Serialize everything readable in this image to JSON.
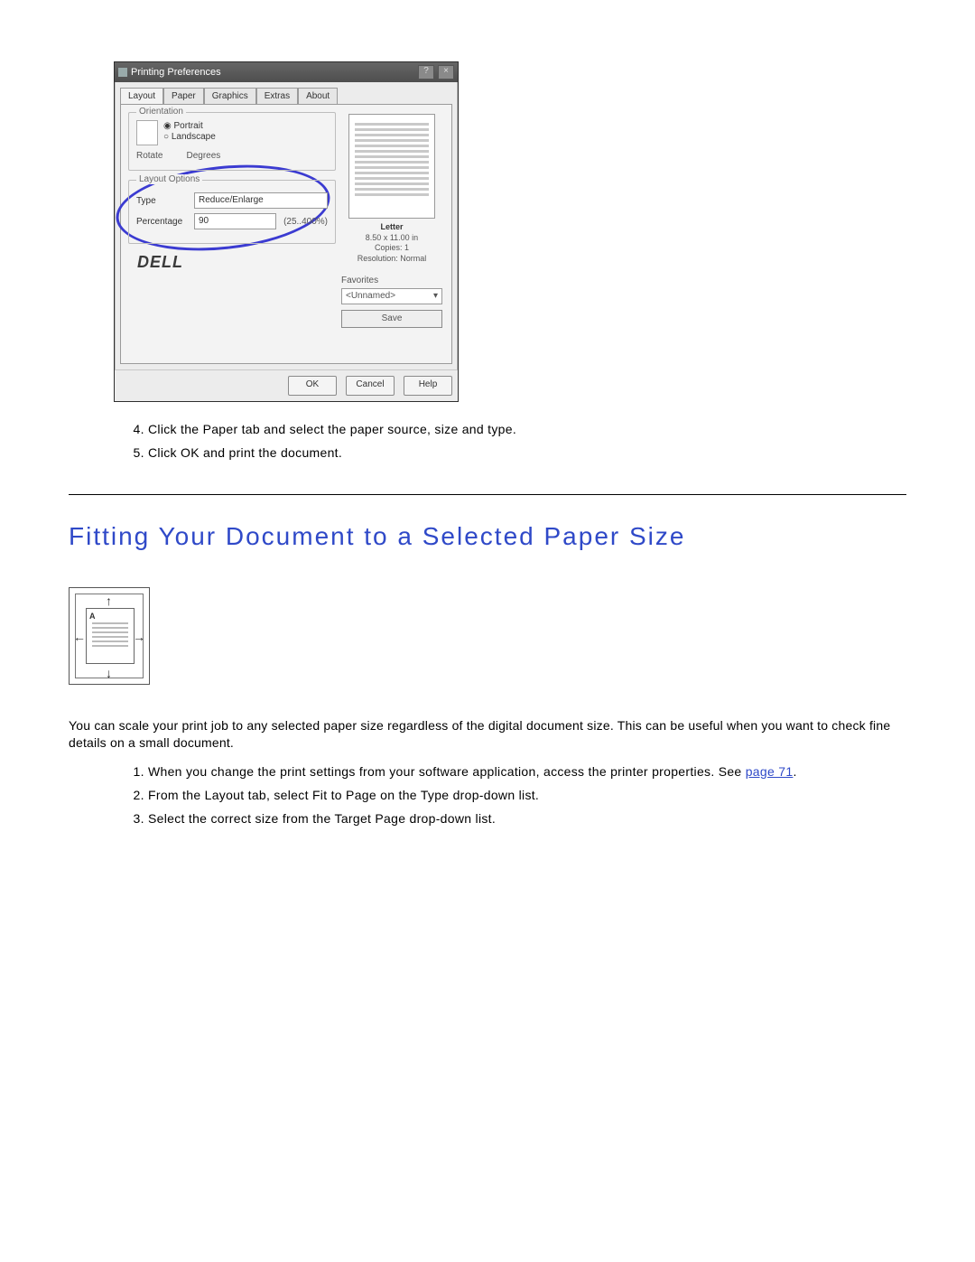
{
  "dialog": {
    "title": "Printing Preferences",
    "winbtn_help": "?",
    "winbtn_close": "×",
    "tabs": [
      "Layout",
      "Paper",
      "Graphics",
      "Extras",
      "About"
    ],
    "orientation": {
      "legend": "Orientation",
      "portrait": "Portrait",
      "landscape": "Landscape",
      "rotate": "Rotate",
      "degrees": "Degrees"
    },
    "layout_options": {
      "legend": "Layout Options",
      "type_lbl": "Type",
      "type_val": "Reduce/Enlarge",
      "pct_lbl": "Percentage",
      "pct_val": "90",
      "pct_unit": "(25..400%)"
    },
    "preview": {
      "paper": "Letter",
      "dims": "8.50 x 11.00 in",
      "copies_lbl": "Copies:",
      "copies_val": "1",
      "res_lbl": "Resolution:",
      "res_val": "Normal"
    },
    "favorites": {
      "legend": "Favorites",
      "value": "<Unnamed>",
      "save": "Save"
    },
    "brand": "DELL",
    "buttons": {
      "ok": "OK",
      "cancel": "Cancel",
      "help": "Help"
    }
  },
  "steps_a": {
    "s4": "Click the Paper tab and select the paper source, size and type.",
    "s5_a": "Click ",
    "s5_b": "OK",
    "s5_c": " and print the document."
  },
  "section_title": "Fitting Your Document to a Selected Paper Size",
  "fiticon": {
    "A": "A"
  },
  "para": "You can scale your print job to any selected paper size regardless of the digital document size. This can be useful when you want to check fine details on a small document.",
  "steps_b": {
    "s1_a": "When you change the print settings from your software application, access the printer properties. See ",
    "s1_link": "page 71",
    "s1_b": ".",
    "s2_a": "From the ",
    "s2_b": "Layout",
    "s2_c": " tab, select ",
    "s2_d": "Fit to Page",
    "s2_e": " on the ",
    "s2_f": "Type",
    "s2_g": " drop-down list.",
    "s3_a": "Select the correct size from the ",
    "s3_b": "Target Page",
    "s3_c": " drop-down list."
  }
}
